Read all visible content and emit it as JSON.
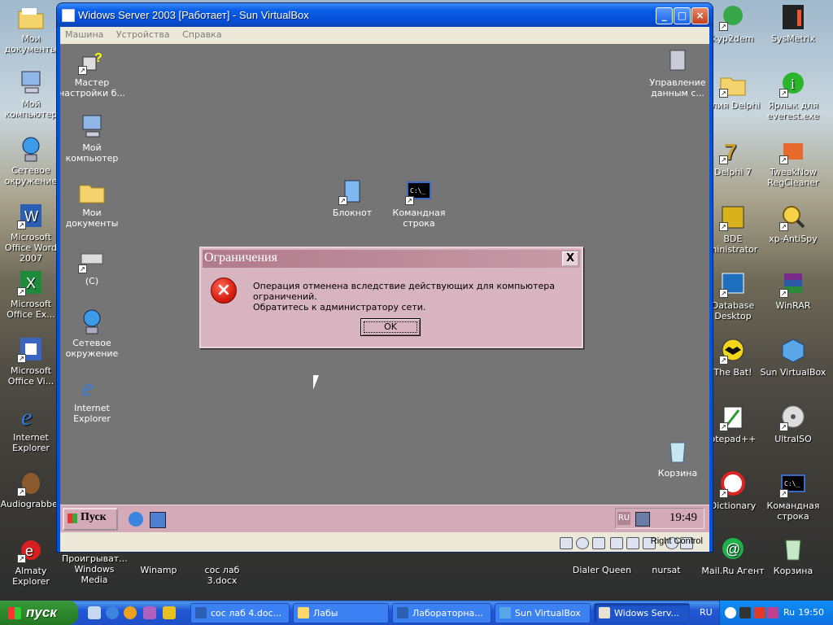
{
  "host_desktop": {
    "icons_left": [
      {
        "label": "Мои документы"
      },
      {
        "label": "Мой компьютер"
      },
      {
        "label": "Сетевое окружение"
      },
      {
        "label": "Microsoft Office Word 2007"
      },
      {
        "label": "Microsoft Office Ex..."
      },
      {
        "label": "Microsoft Office Vi..."
      },
      {
        "label": "Internet Explorer"
      },
      {
        "label": "Audiograbber"
      },
      {
        "label": "Almaty Explorer"
      }
    ],
    "icons_bottom": [
      {
        "label": "Проигрыват... Windows Media"
      },
      {
        "label": "Winamp"
      },
      {
        "label": "сос лаб 3.docx"
      },
      {
        "label": "Dialer Queen"
      },
      {
        "label": "nursat"
      }
    ],
    "icons_right1": [
      {
        "label": "kyp2dem"
      },
      {
        "label": "ллия Delphi"
      },
      {
        "label": "Delphi 7"
      },
      {
        "label": "BDE ministrator"
      },
      {
        "label": "Database Desktop"
      },
      {
        "label": "The Bat!"
      },
      {
        "label": "otepad++"
      },
      {
        "label": "Dictionary"
      },
      {
        "label": "Mail.Ru Агент"
      }
    ],
    "icons_right2": [
      {
        "label": "SysMetrix"
      },
      {
        "label": "Ярлык для everest.exe"
      },
      {
        "label": "TweakNow RegCleaner"
      },
      {
        "label": "xp-AntiSpy"
      },
      {
        "label": "WinRAR"
      },
      {
        "label": "Sun VirtualBox"
      },
      {
        "label": "UltraISO"
      },
      {
        "label": "Командная строка"
      },
      {
        "label": "Корзина"
      }
    ]
  },
  "vbox": {
    "title": "Widows Server 2003 [Работает] - Sun VirtualBox",
    "menu": [
      "Машина",
      "Устройства",
      "Справка"
    ],
    "status_right": "Right Control"
  },
  "guest": {
    "icons": [
      {
        "label": "Мастер настройки б..."
      },
      {
        "label": "Мой компьютер"
      },
      {
        "label": "Мои документы"
      },
      {
        "label": "(C)"
      },
      {
        "label": "Сетевое окружение"
      },
      {
        "label": "Internet Explorer"
      },
      {
        "label": "Блокнот"
      },
      {
        "label": "Командная строка"
      },
      {
        "label": "Управление данным с..."
      },
      {
        "label": "Корзина"
      }
    ],
    "taskbar": {
      "start": "Пуск",
      "lang": "RU",
      "clock": "19:49"
    },
    "dialog": {
      "title": "Ограничения",
      "close": "X",
      "line1": "Операция отменена вследствие действующих для компьютера ограничений.",
      "line2": "Обратитесь к администратору сети.",
      "ok": "OK"
    }
  },
  "host_taskbar": {
    "start": "пуск",
    "buttons": [
      "сос лаб 4.doc...",
      "Лабы",
      "Лабораторна...",
      "Sun VirtualBox",
      "Widows Serv..."
    ],
    "lang": "RU",
    "tray_lang": "Ru",
    "clock": "19:50"
  }
}
